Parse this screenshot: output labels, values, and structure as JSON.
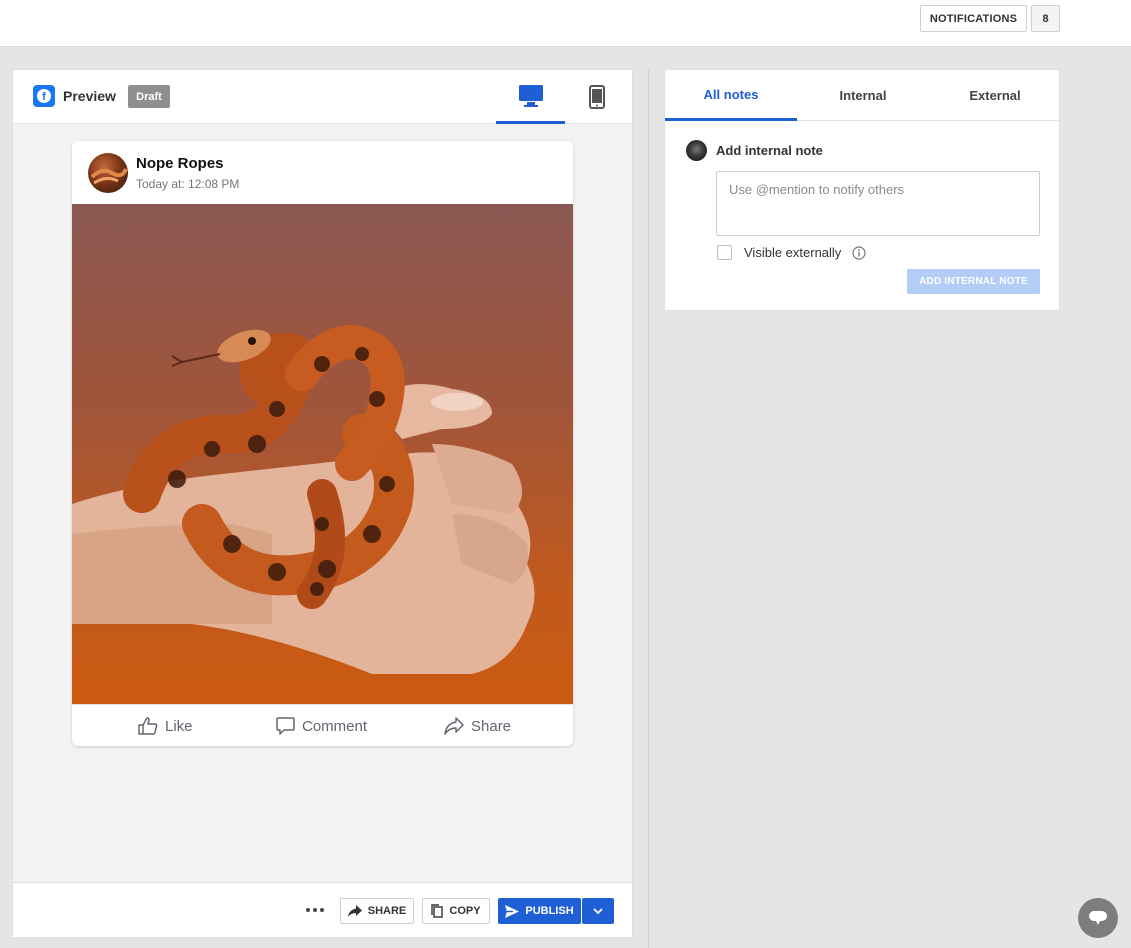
{
  "topbar": {
    "notifications_label": "NOTIFICATIONS",
    "notifications_count": "8"
  },
  "preview": {
    "network_icon": "facebook-icon",
    "label": "Preview",
    "status_badge": "Draft",
    "view_modes": [
      {
        "name": "desktop",
        "icon": "desktop-icon",
        "active": true
      },
      {
        "name": "mobile",
        "icon": "mobile-phone-icon",
        "active": false
      }
    ]
  },
  "post": {
    "page_name": "Nope Ropes",
    "timestamp": "Today at: 12:08 PM",
    "image_subject": "snake-in-hand-photo",
    "actions": {
      "like": "Like",
      "comment": "Comment",
      "share": "Share"
    }
  },
  "bottom_bar": {
    "more_icon": "more-horizontal-icon",
    "share_label": "SHARE",
    "copy_label": "COPY",
    "publish_label": "PUBLISH"
  },
  "notes": {
    "tabs": [
      {
        "label": "All notes",
        "active": true
      },
      {
        "label": "Internal",
        "active": false
      },
      {
        "label": "External",
        "active": false
      }
    ],
    "add_title": "Add internal note",
    "input_placeholder": "Use @mention to notify others",
    "visible_externally_label": "Visible externally",
    "submit_label": "ADD INTERNAL NOTE"
  },
  "colors": {
    "accent": "#1f5fd6",
    "facebook": "#1877f2",
    "draft_badge": "#8f8f8f",
    "disabled_button": "#b3cdf7"
  }
}
